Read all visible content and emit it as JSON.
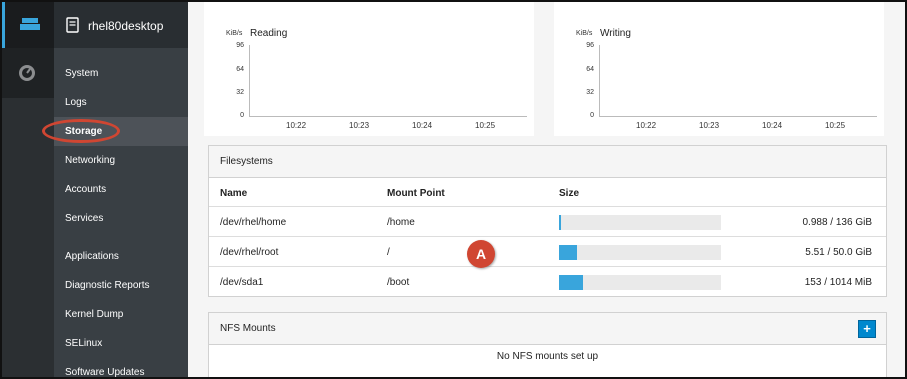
{
  "host": {
    "name": "rhel80desktop"
  },
  "nav": {
    "items": [
      {
        "label": "System",
        "active": false
      },
      {
        "label": "Logs",
        "active": false
      },
      {
        "label": "Storage",
        "active": true
      },
      {
        "label": "Networking",
        "active": false
      },
      {
        "label": "Accounts",
        "active": false
      },
      {
        "label": "Services",
        "active": false
      },
      {
        "label": "Applications",
        "active": false
      },
      {
        "label": "Diagnostic Reports",
        "active": false
      },
      {
        "label": "Kernel Dump",
        "active": false
      },
      {
        "label": "SELinux",
        "active": false
      },
      {
        "label": "Software Updates",
        "active": false
      }
    ]
  },
  "graphs": {
    "reading": {
      "unit": "KiB/s",
      "title": "Reading",
      "yticks": [
        "96",
        "64",
        "32",
        "0"
      ],
      "xticks": [
        "10:22",
        "10:23",
        "10:24",
        "10:25"
      ]
    },
    "writing": {
      "unit": "KiB/s",
      "title": "Writing",
      "yticks": [
        "96",
        "64",
        "32",
        "0"
      ],
      "xticks": [
        "10:22",
        "10:23",
        "10:24",
        "10:25"
      ]
    }
  },
  "filesystems": {
    "title": "Filesystems",
    "columns": {
      "name": "Name",
      "mount": "Mount Point",
      "size": "Size"
    },
    "rows": [
      {
        "name": "/dev/rhel/home",
        "mount": "/home",
        "size": "0.988 / 136 GiB",
        "used_fraction": 0.007
      },
      {
        "name": "/dev/rhel/root",
        "mount": "/",
        "size": "5.51 / 50.0 GiB",
        "used_fraction": 0.11
      },
      {
        "name": "/dev/sda1",
        "mount": "/boot",
        "size": "153 / 1014 MiB",
        "used_fraction": 0.15
      }
    ]
  },
  "annotation": {
    "badge": "A"
  },
  "nfs": {
    "title": "NFS Mounts",
    "add_label": "+",
    "empty": "No NFS mounts set up"
  },
  "colors": {
    "accent": "#39a5dc",
    "highlight": "#d04632",
    "nav_bg": "#393f44"
  }
}
